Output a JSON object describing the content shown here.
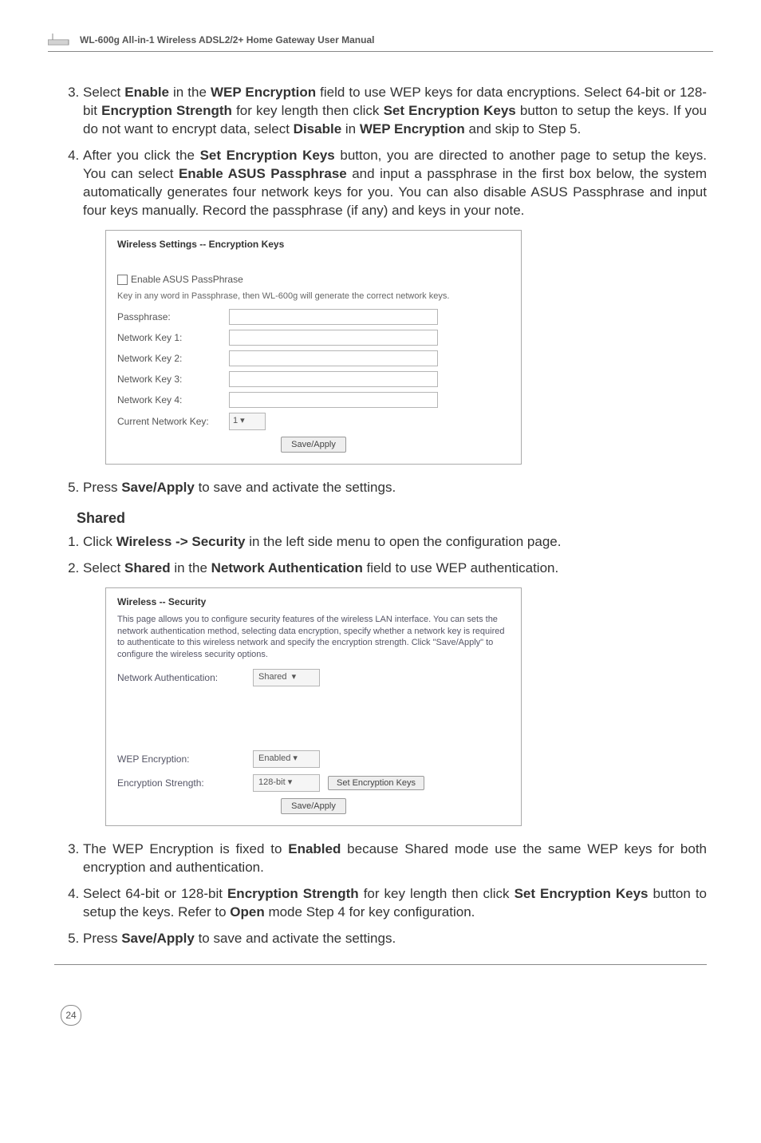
{
  "header": {
    "title": "WL-600g All-in-1 Wireless ADSL2/2+ Home Gateway User Manual"
  },
  "steps_a": [
    {
      "pre": "Select ",
      "b1": "Enable",
      "mid1": " in the ",
      "b2": "WEP Encryption",
      "mid2": " field to use WEP keys for data encryptions. Select 64-bit or 128-bit ",
      "b3": "Encryption Strength",
      "mid3": " for key length then click ",
      "b4": "Set Encryption Keys",
      "mid4": " button to setup the keys. If you do not want to encrypt data, select ",
      "b5": "Disable",
      "mid5": " in ",
      "b6": "WEP Encryption",
      "post": " and skip to Step 5."
    },
    {
      "pre": "After you click the ",
      "b1": "Set Encryption Keys",
      "mid1": " button, you are directed to another page to setup the keys. You can select ",
      "b2": "Enable ASUS Passphrase",
      "mid2": " and input a passphrase in the first box below, the system automatically generates four network keys for you. You can also disable ASUS Passphrase and input four keys manually. Record the passphrase (if any) and keys in your note."
    }
  ],
  "screenshot1": {
    "title": "Wireless Settings -- Encryption Keys",
    "checkbox_label": "Enable ASUS PassPhrase",
    "desc": "Key in any word in Passphrase, then WL-600g will generate the correct network keys.",
    "rows": [
      "Passphrase:",
      "Network Key 1:",
      "Network Key 2:",
      "Network Key 3:",
      "Network Key 4:"
    ],
    "current_key_label": "Current Network Key:",
    "current_key_value": "1",
    "save_btn": "Save/Apply"
  },
  "step5a": {
    "pre": "Press ",
    "b1": "Save/Apply",
    "post": " to save and activate the settings."
  },
  "shared_heading": "Shared",
  "steps_b": [
    {
      "pre": "Click ",
      "b1": "Wireless -> Security",
      "post": " in the left side menu to open the configuration page."
    },
    {
      "pre": "Select ",
      "b1": "Shared",
      "mid1": " in the ",
      "b2": "Network Authentication",
      "post": " field to use WEP authentication."
    }
  ],
  "screenshot2": {
    "title": "Wireless -- Security",
    "para": "This page allows you to configure security features of the wireless LAN interface. You can sets the network authentication method, selecting data encryption, specify whether a network key is required to authenticate to this wireless network and specify the encryption strength.\nClick \"Save/Apply\" to configure the wireless security options.",
    "auth_label": "Network Authentication:",
    "auth_value": "Shared",
    "wep_label": "WEP Encryption:",
    "wep_value": "Enabled",
    "enc_label": "Encryption Strength:",
    "enc_value": "128-bit",
    "set_keys_btn": "Set Encryption Keys",
    "save_btn": "Save/Apply"
  },
  "steps_c": [
    {
      "pre": "The WEP Encryption is fixed to ",
      "b1": "Enabled",
      "post": " because Shared mode use the same WEP keys for both encryption and authentication."
    },
    {
      "pre": "Select 64-bit or 128-bit ",
      "b1": "Encryption Strength",
      "mid1": " for key length then click ",
      "b2": "Set Encryption Keys",
      "mid2": " button to setup the keys. Refer to ",
      "b3": "Open",
      "post": " mode Step 4 for key configuration."
    },
    {
      "pre": "Press ",
      "b1": "Save/Apply",
      "post": " to save and activate the settings."
    }
  ],
  "page_number": "24"
}
